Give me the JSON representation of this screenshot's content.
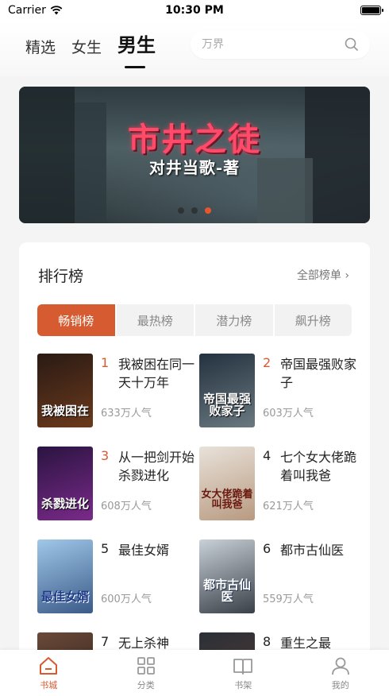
{
  "status_bar": {
    "carrier": "Carrier",
    "time": "10:30 PM"
  },
  "header": {
    "tabs": [
      {
        "label": "精选",
        "active": false
      },
      {
        "label": "女生",
        "active": false
      },
      {
        "label": "男生",
        "active": true
      }
    ],
    "search_placeholder": "万界"
  },
  "banner": {
    "title": "市井之徒",
    "subtitle": "对井当歌-著",
    "slide_count": 3,
    "active_slide": 3
  },
  "ranking": {
    "title": "排行榜",
    "all_link": "全部榜单",
    "tabs": [
      "畅销榜",
      "最热榜",
      "潜力榜",
      "飙升榜"
    ],
    "active_tab": 0,
    "books": [
      {
        "rank": "1",
        "name": "我被困在同一天十万年",
        "popularity": "633万人气",
        "cover_text": "我被困在",
        "cover_colors": [
          "#2a1a14",
          "#6b3a1c"
        ]
      },
      {
        "rank": "2",
        "name": "帝国最强败家子",
        "popularity": "603万人气",
        "cover_text": "帝国最强败家子",
        "cover_colors": [
          "#243240",
          "#6a7880"
        ]
      },
      {
        "rank": "3",
        "name": "从一把剑开始杀戮进化",
        "popularity": "608万人气",
        "cover_text": "杀戮进化",
        "cover_colors": [
          "#2a1440",
          "#7a2a8a"
        ]
      },
      {
        "rank": "4",
        "name": "七个女大佬跪着叫我爸",
        "popularity": "621万人气",
        "cover_text": "女大佬跪着叫我爸",
        "cover_colors": [
          "#e8e2da",
          "#b89a80"
        ]
      },
      {
        "rank": "5",
        "name": "最佳女婿",
        "popularity": "600万人气",
        "cover_text": "最佳女婿",
        "cover_colors": [
          "#a0c8e8",
          "#3a5a88"
        ]
      },
      {
        "rank": "6",
        "name": "都市古仙医",
        "popularity": "559万人气",
        "cover_text": "都市古仙医",
        "cover_colors": [
          "#c8d0d8",
          "#3a4048"
        ]
      },
      {
        "rank": "7",
        "name": "无上杀神",
        "popularity": "",
        "cover_text": "",
        "cover_colors": [
          "#6a4a3a",
          "#2a1a14"
        ]
      },
      {
        "rank": "8",
        "name": "重生之最",
        "popularity": "",
        "cover_text": "",
        "cover_colors": [
          "#2a3038",
          "#5a3a30"
        ]
      }
    ]
  },
  "bottom_nav": [
    {
      "label": "书城",
      "icon": "home-icon",
      "active": true
    },
    {
      "label": "分类",
      "icon": "grid-icon",
      "active": false
    },
    {
      "label": "书架",
      "icon": "book-icon",
      "active": false
    },
    {
      "label": "我的",
      "icon": "user-icon",
      "active": false
    }
  ],
  "colors": {
    "accent": "#d75b30",
    "banner_title": "#ff4a6a"
  }
}
